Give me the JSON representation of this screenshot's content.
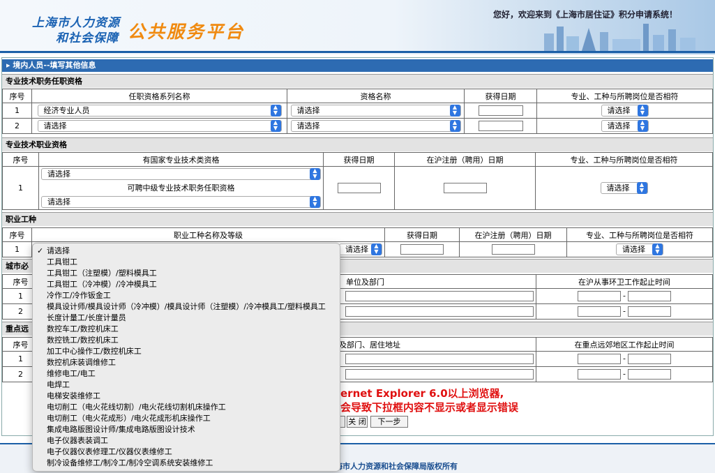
{
  "header": {
    "logo_line1": "上海市人力资源",
    "logo_line2": "和社会保障",
    "logo_big": "公共服务平台",
    "welcome": "您好，欢迎来到《上海市居住证》积分申请系统！"
  },
  "page_title": "境内人员--填写其他信息",
  "section1": {
    "title": "专业技术职务任职资格",
    "headers": [
      "序号",
      "任职资格系列名称",
      "资格名称",
      "获得日期",
      "专业、工种与所聘岗位是否相符"
    ],
    "rows": [
      {
        "no": "1",
        "series": "经济专业人员",
        "qualification": "请选择",
        "date": "",
        "match": "请选择"
      },
      {
        "no": "2",
        "series": "请选择",
        "qualification": "请选择",
        "date": "",
        "match": "请选择"
      }
    ]
  },
  "section2": {
    "title": "专业技术职业资格",
    "headers": [
      "序号",
      "有国家专业技术类资格",
      "获得日期",
      "在沪注册（聘用）日期",
      "专业、工种与所聘岗位是否相符"
    ],
    "row": {
      "no": "1",
      "select1": "请选择",
      "middle_text": "可聘中级专业技术职务任职资格",
      "select2": "请选择",
      "match": "请选择"
    }
  },
  "section3": {
    "title": "职业工种",
    "headers": [
      "序号",
      "职业工种名称及等级",
      "获得日期",
      "在沪注册（聘用）日期",
      "专业、工种与所聘岗位是否相符"
    ],
    "row": {
      "no": "1",
      "level_select": "请选择",
      "match": "请选择"
    }
  },
  "section4": {
    "title_visible": "城市必",
    "headers_visible": [
      "序号",
      "单位及部门",
      "在沪从事环卫工作起止时间"
    ],
    "rows": [
      {
        "no": "1"
      },
      {
        "no": "2"
      }
    ],
    "dash": "-"
  },
  "section5": {
    "title_visible": "重点远",
    "headers_visible": [
      "序号",
      "及部门、居住地址",
      "在重点远郊地区工作起止时间"
    ],
    "rows": [
      {
        "no": "1"
      },
      {
        "no": "2"
      }
    ],
    "dash": "-"
  },
  "warning": {
    "line1": "ernet Explorer 6.0以上浏览器,",
    "line2": "会导致下拉框内容不显示或者显示错误"
  },
  "buttons": {
    "close": "关 闭",
    "next": "下一步"
  },
  "footer": {
    "copyright": "海市人力资源和社会保障局版权所有"
  },
  "dropdown": {
    "selected_index": 0,
    "options": [
      "请选择",
      "工具钳工",
      "工具钳工（注塑模）/塑料模具工",
      "工具钳工（冷冲模）/冷冲模具工",
      "冷作工/冷作钣金工",
      "模具设计师/模具设计师（冷冲模）/模具设计师（注塑模）/冷冲模具工/塑料模具工",
      "长度计量工/长度计量员",
      "数控车工/数控机床工",
      "数控铣工/数控机床工",
      "加工中心操作工/数控机床工",
      "数控机床装调维修工",
      "维修电工/电工",
      "电焊工",
      "电梯安装维修工",
      "电切削工（电火花线切割）/电火花线切割机床操作工",
      "电切削工（电火花成形）/电火花成形机床操作工",
      "集成电路版图设计师/集成电路版图设计技术",
      "电子仪器表装调工",
      "电子仪器仪表修理工/仪器仪表维修工",
      "制冷设备维修工/制冷工/制冷空调系统安装维修工"
    ]
  }
}
